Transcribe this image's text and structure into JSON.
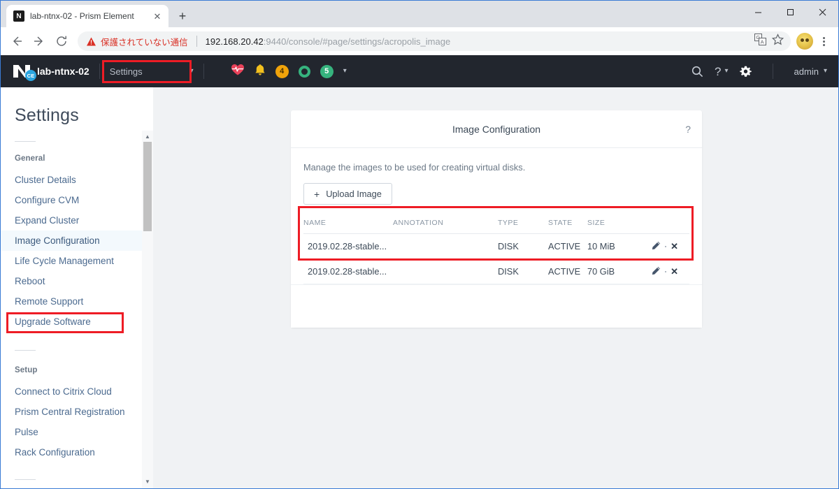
{
  "browser": {
    "tab": {
      "title": "lab-ntnx-02 - Prism Element",
      "favicon_letter": "N",
      "close_icon": "close-icon"
    },
    "new_tab_label": "+",
    "window_controls": {
      "minimize": "minimize-icon",
      "maximize": "maximize-icon",
      "close": "close-icon"
    },
    "nav": {
      "back": "back-arrow-icon",
      "forward": "forward-arrow-icon",
      "reload": "reload-icon"
    },
    "omnibox": {
      "security_warning": "保護されていない通信",
      "url_host": "192.168.20.42",
      "url_rest": ":9440/console/#page/settings/acropolis_image",
      "translate_icon": "translate-icon",
      "bookmark_icon": "star-icon"
    },
    "profile_icon": "avatar-icon",
    "menu_icon": "kebab-menu-icon"
  },
  "topbar": {
    "logo": "nutanix-logo-icon",
    "ce_badge": "CE",
    "cluster_name": "lab-ntnx-02",
    "context_select": {
      "label": "Settings",
      "chevron": "chevron-down-icon"
    },
    "status": {
      "health_icon": "heart-pulse-icon",
      "alert_icon": "bell-icon",
      "alert_count": "4",
      "task_ring_icon": "progress-ring-icon",
      "event_count": "5",
      "chevron": "chevron-down-icon"
    },
    "right": {
      "search_icon": "search-icon",
      "help_icon": "question-mark-icon",
      "help_chevron": "chevron-down-icon",
      "settings_icon": "gear-icon",
      "user_label": "admin",
      "user_chevron": "chevron-down-icon"
    }
  },
  "sidebar": {
    "title": "Settings",
    "groups": [
      {
        "label": "General",
        "items": [
          {
            "label": "Cluster Details",
            "active": false
          },
          {
            "label": "Configure CVM",
            "active": false
          },
          {
            "label": "Expand Cluster",
            "active": false
          },
          {
            "label": "Image Configuration",
            "active": true
          },
          {
            "label": "Life Cycle Management",
            "active": false
          },
          {
            "label": "Reboot",
            "active": false
          },
          {
            "label": "Remote Support",
            "active": false
          },
          {
            "label": "Upgrade Software",
            "active": false
          }
        ]
      },
      {
        "label": "Setup",
        "items": [
          {
            "label": "Connect to Citrix Cloud",
            "active": false
          },
          {
            "label": "Prism Central Registration",
            "active": false
          },
          {
            "label": "Pulse",
            "active": false
          },
          {
            "label": "Rack Configuration",
            "active": false
          }
        ]
      }
    ],
    "scrollbar": {
      "up_arrow": "chevron-up-icon",
      "down_arrow": "chevron-down-icon"
    }
  },
  "main": {
    "card_title": "Image Configuration",
    "help_icon_label": "?",
    "description": "Manage the images to be used for creating virtual disks.",
    "upload_button": {
      "label": "Upload Image",
      "plus": "+"
    },
    "table": {
      "headers": [
        "NAME",
        "ANNOTATION",
        "TYPE",
        "STATE",
        "SIZE",
        ""
      ],
      "rows": [
        {
          "name": "2019.02.28-stable...",
          "annotation": "",
          "type": "DISK",
          "state": "ACTIVE",
          "size": "10 MiB",
          "edit_icon": "pencil-icon",
          "delete_icon": "close-icon"
        },
        {
          "name": "2019.02.28-stable...",
          "annotation": "",
          "type": "DISK",
          "state": "ACTIVE",
          "size": "70 GiB",
          "edit_icon": "pencil-icon",
          "delete_icon": "close-icon"
        }
      ]
    }
  },
  "annotations": {
    "highlight_color": "#ee1c25",
    "boxes": [
      "settings-dropdown",
      "sidebar-image-configuration",
      "image-table-rows"
    ]
  }
}
